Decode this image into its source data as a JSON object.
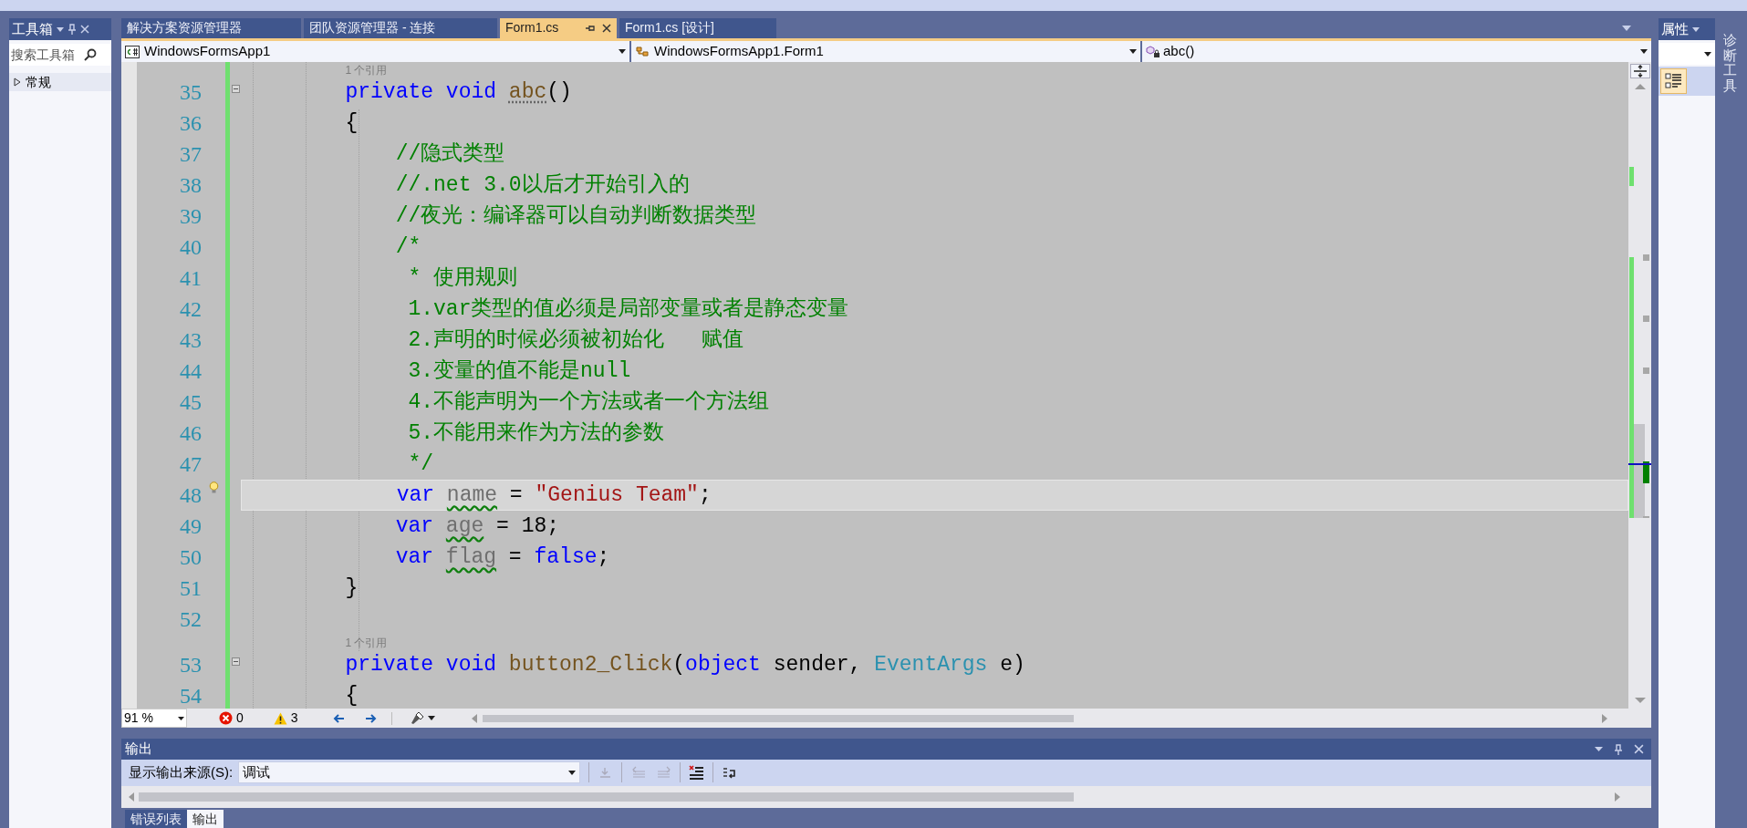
{
  "toolbox": {
    "title": "工具箱",
    "search": {
      "placeholder": "搜索工具箱"
    },
    "groups": [
      {
        "label": "常规",
        "expanded": false
      }
    ]
  },
  "doc_tabs": [
    {
      "label": "解决方案资源管理器",
      "selected": false
    },
    {
      "label": "团队资源管理器 - 连接",
      "selected": false
    },
    {
      "label": "Form1.cs",
      "selected": true
    },
    {
      "label": "Form1.cs [设计]",
      "selected": false
    }
  ],
  "navigation_bar": {
    "project": "WindowsFormsApp1",
    "type": "WindowsFormsApp1.Form1",
    "member": "abc()"
  },
  "editor": {
    "lines": [
      {
        "number": "35",
        "codelens": "1 个引用",
        "changed": true,
        "foldable": true,
        "current": false,
        "tokens": [
          {
            "kind": "keyword",
            "text": "        private "
          },
          {
            "kind": "keyword",
            "text": "void "
          },
          {
            "kind": "suggestion",
            "text": "abc"
          },
          {
            "kind": "plain",
            "text": "()"
          }
        ]
      },
      {
        "number": "36",
        "changed": true,
        "foldable": false,
        "current": false,
        "tokens": [
          {
            "kind": "plain",
            "text": "        {"
          }
        ]
      },
      {
        "number": "37",
        "changed": true,
        "foldable": false,
        "current": false,
        "tokens": [
          {
            "kind": "comment",
            "text": "            //隐式类型"
          }
        ]
      },
      {
        "number": "38",
        "changed": true,
        "foldable": false,
        "current": false,
        "tokens": [
          {
            "kind": "comment",
            "text": "            //.net 3.0以后才开始引入的"
          }
        ]
      },
      {
        "number": "39",
        "changed": true,
        "foldable": false,
        "current": false,
        "tokens": [
          {
            "kind": "comment",
            "text": "            //夜光：编译器可以自动判断数据类型"
          }
        ]
      },
      {
        "number": "40",
        "changed": true,
        "foldable": false,
        "current": false,
        "tokens": [
          {
            "kind": "comment",
            "text": "            /*"
          }
        ]
      },
      {
        "number": "41",
        "changed": true,
        "foldable": false,
        "current": false,
        "tokens": [
          {
            "kind": "comment",
            "text": "             * 使用规则"
          }
        ]
      },
      {
        "number": "42",
        "changed": true,
        "foldable": false,
        "current": false,
        "tokens": [
          {
            "kind": "comment",
            "text": "             1.var类型的值必须是局部变量或者是静态变量"
          }
        ]
      },
      {
        "number": "43",
        "changed": true,
        "foldable": false,
        "current": false,
        "tokens": [
          {
            "kind": "comment",
            "text": "             2.声明的时候必须被初始化   赋值"
          }
        ]
      },
      {
        "number": "44",
        "changed": true,
        "foldable": false,
        "current": false,
        "tokens": [
          {
            "kind": "comment",
            "text": "             3.变量的值不能是null"
          }
        ]
      },
      {
        "number": "45",
        "changed": true,
        "foldable": false,
        "current": false,
        "tokens": [
          {
            "kind": "comment",
            "text": "             4.不能声明为一个方法或者一个方法组"
          }
        ]
      },
      {
        "number": "46",
        "changed": true,
        "foldable": false,
        "current": false,
        "tokens": [
          {
            "kind": "comment",
            "text": "             5.不能用来作为方法的参数"
          }
        ]
      },
      {
        "number": "47",
        "changed": true,
        "foldable": false,
        "current": false,
        "tokens": [
          {
            "kind": "comment",
            "text": "             */"
          }
        ]
      },
      {
        "number": "48",
        "changed": true,
        "foldable": false,
        "current": true,
        "tokens": [
          {
            "kind": "keyword",
            "text": "            var "
          },
          {
            "kind": "unused",
            "text": "name"
          },
          {
            "kind": "plain",
            "text": " = "
          },
          {
            "kind": "string",
            "text": "\"Genius Team\""
          },
          {
            "kind": "plain",
            "text": ";"
          }
        ]
      },
      {
        "number": "49",
        "changed": true,
        "foldable": false,
        "current": false,
        "tokens": [
          {
            "kind": "keyword",
            "text": "            var "
          },
          {
            "kind": "unused",
            "text": "age"
          },
          {
            "kind": "plain",
            "text": " = 18;"
          }
        ]
      },
      {
        "number": "50",
        "changed": true,
        "foldable": false,
        "current": false,
        "tokens": [
          {
            "kind": "keyword",
            "text": "            var "
          },
          {
            "kind": "unused",
            "text": "flag"
          },
          {
            "kind": "plain",
            "text": " = "
          },
          {
            "kind": "keyword",
            "text": "false"
          },
          {
            "kind": "plain",
            "text": ";"
          }
        ]
      },
      {
        "number": "51",
        "changed": true,
        "foldable": false,
        "current": false,
        "tokens": [
          {
            "kind": "plain",
            "text": "        }"
          }
        ]
      },
      {
        "number": "52",
        "changed": true,
        "foldable": false,
        "current": false
      },
      {
        "number": "53",
        "codelens": "1 个引用",
        "changed": true,
        "foldable": true,
        "current": false,
        "tokens": [
          {
            "kind": "keyword",
            "text": "        private "
          },
          {
            "kind": "keyword",
            "text": "void "
          },
          {
            "kind": "method",
            "text": "button2_Click"
          },
          {
            "kind": "plain",
            "text": "("
          },
          {
            "kind": "keyword",
            "text": "object"
          },
          {
            "kind": "plain",
            "text": " sender, "
          },
          {
            "kind": "type",
            "text": "EventArgs"
          },
          {
            "kind": "plain",
            "text": " e)"
          }
        ]
      },
      {
        "number": "54",
        "changed": true,
        "foldable": false,
        "current": false,
        "tokens": [
          {
            "kind": "plain",
            "text": "        {"
          }
        ]
      }
    ]
  },
  "status": {
    "zoom": "91 %",
    "errors": "0",
    "warnings": "3"
  },
  "output": {
    "title": "输出",
    "source_label": "显示输出来源(S):",
    "source": "调试"
  },
  "bottom_tabs": [
    {
      "label": "错误列表",
      "selected": false
    },
    {
      "label": "输出",
      "selected": true
    }
  ],
  "properties": {
    "title": "属性"
  },
  "side_tab": "诊断工具"
}
